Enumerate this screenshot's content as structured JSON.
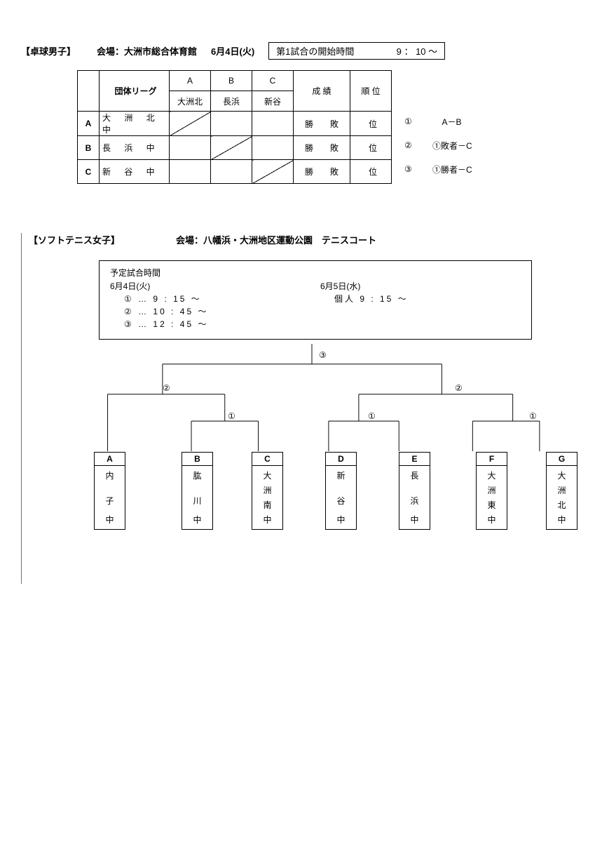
{
  "tabletennis": {
    "title": "【卓球男子】",
    "venue_label": "会場：大洲市総合体育館",
    "date": "6月4日(火)",
    "start_label": "第1試合の開始時間",
    "start_time": "9 ： 10  ～",
    "league_header": "団体リーグ",
    "cols": [
      "A",
      "B",
      "C"
    ],
    "col_teams": [
      "大洲北",
      "長浜",
      "新谷"
    ],
    "result_header": "成 績",
    "rank_header": "順 位",
    "rows": [
      {
        "label": "A",
        "name": "大 洲 北 中"
      },
      {
        "label": "B",
        "name": "長   浜  中"
      },
      {
        "label": "C",
        "name": "新   谷  中"
      }
    ],
    "cell_text": "勝　　敗",
    "rank_text": "位",
    "matches": [
      {
        "num": "①",
        "text": "A－B"
      },
      {
        "num": "②",
        "text": "①敗者－C"
      },
      {
        "num": "③",
        "text": "①勝者－C"
      }
    ]
  },
  "softtennis": {
    "title": "【ソフトテニス女子】",
    "venue_label": "会場：八幡浜・大洲地区運動公園　テニスコート",
    "schedule_title": "予定試合時間",
    "day1": "6月4日(火)",
    "day2": "6月5日(水)",
    "day1_lines": [
      "① … 9 : 15  ～",
      "② … 10 : 45  ～",
      "③ … 12 : 45  ～"
    ],
    "day2_line": "個人   9 : 15  ～",
    "round3": "③",
    "round2": "②",
    "round1": "①",
    "teams": [
      {
        "letter": "A",
        "chars": [
          "内",
          "",
          "子",
          "中"
        ]
      },
      {
        "letter": "B",
        "chars": [
          "肱",
          "",
          "川",
          "中"
        ]
      },
      {
        "letter": "C",
        "chars": [
          "大",
          "洲",
          "南",
          "中"
        ]
      },
      {
        "letter": "D",
        "chars": [
          "新",
          "",
          "谷",
          "中"
        ]
      },
      {
        "letter": "E",
        "chars": [
          "長",
          "",
          "浜",
          "中"
        ]
      },
      {
        "letter": "F",
        "chars": [
          "大",
          "洲",
          "東",
          "中"
        ]
      },
      {
        "letter": "G",
        "chars": [
          "大",
          "洲",
          "北",
          "中"
        ]
      }
    ]
  }
}
